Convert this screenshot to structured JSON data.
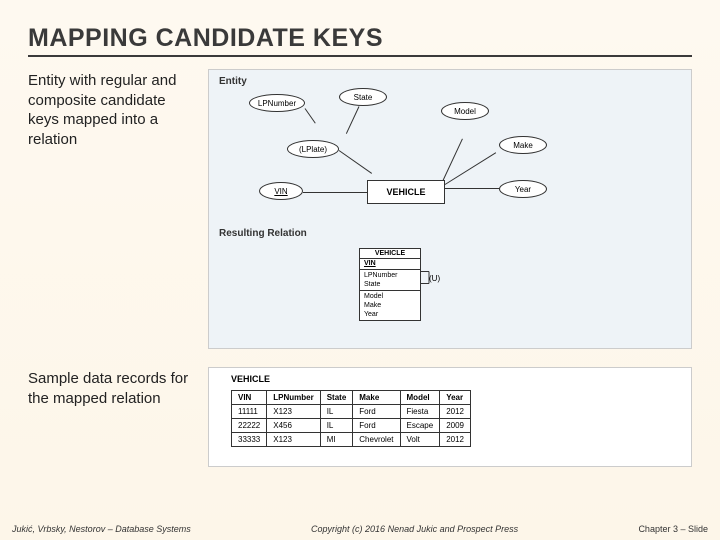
{
  "title": "MAPPING CANDIDATE KEYS",
  "desc1": "Entity with regular and composite candidate keys mapped into a relation",
  "desc2": "Sample data records for the mapped relation",
  "fig1": {
    "entity_label": "Entity",
    "resulting_label": "Resulting Relation",
    "attrs": {
      "lpnumber": "LPNumber",
      "state": "State",
      "model": "Model",
      "lplate": "(LPlate)",
      "make": "Make",
      "vin": "VIN",
      "year": "Year"
    },
    "entity_name": "VEHICLE",
    "relation": {
      "name": "VEHICLE",
      "pk": "VIN",
      "attrs": [
        "LPNumber",
        "State",
        "Model",
        "Make",
        "Year"
      ],
      "unique_note": "(U)"
    }
  },
  "fig2": {
    "name": "VEHICLE",
    "headers": [
      "VIN",
      "LPNumber",
      "State",
      "Make",
      "Model",
      "Year"
    ],
    "rows": [
      [
        "11111",
        "X123",
        "IL",
        "Ford",
        "Fiesta",
        "2012"
      ],
      [
        "22222",
        "X456",
        "IL",
        "Ford",
        "Escape",
        "2009"
      ],
      [
        "33333",
        "X123",
        "MI",
        "Chevrolet",
        "Volt",
        "2012"
      ]
    ]
  },
  "footer": {
    "left": "Jukić, Vrbsky, Nestorov – Database Systems",
    "center": "Copyright (c) 2016 Nenad Jukic and Prospect Press",
    "right": "Chapter 3 – Slide"
  },
  "chart_data": {
    "type": "table",
    "title": "VEHICLE",
    "headers": [
      "VIN",
      "LPNumber",
      "State",
      "Make",
      "Model",
      "Year"
    ],
    "rows": [
      [
        "11111",
        "X123",
        "IL",
        "Ford",
        "Fiesta",
        "2012"
      ],
      [
        "22222",
        "X456",
        "IL",
        "Ford",
        "Escape",
        "2009"
      ],
      [
        "33333",
        "X123",
        "MI",
        "Chevrolet",
        "Volt",
        "2012"
      ]
    ]
  }
}
